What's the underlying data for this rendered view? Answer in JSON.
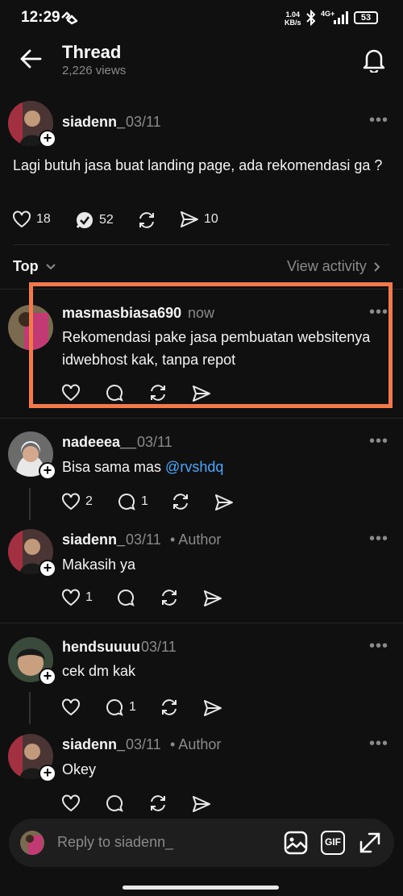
{
  "status": {
    "time": "12:29",
    "net_speed": "1.04",
    "net_unit": "KB/s",
    "network": "4G+",
    "battery": "53"
  },
  "header": {
    "title": "Thread",
    "views": "2,226 views"
  },
  "post": {
    "username": "siadenn_",
    "date": "03/11",
    "text": "Lagi butuh jasa buat landing page, ada rekomendasi ga ?",
    "likes": "18",
    "replies": "52",
    "shares": "10"
  },
  "sort": {
    "label": "Top",
    "view_activity": "View activity"
  },
  "replies": [
    {
      "username": "masmasbiasa690",
      "time": "now",
      "text_line1": "Rekomendasi pake jasa pembuatan websitenya",
      "text_line2": "idwebhost kak, tanpa repot"
    },
    {
      "username": "nadeeea__",
      "date": "03/11",
      "text": "Bisa sama mas ",
      "mention": "@rvshdq",
      "likes": "2",
      "replies": "1"
    },
    {
      "username": "siadenn_",
      "date": "03/11",
      "author": "• Author",
      "text": "Makasih ya",
      "likes": "1"
    },
    {
      "username": "hendsuuuu",
      "date": "03/11",
      "text": "cek dm kak",
      "replies": "1"
    },
    {
      "username": "siadenn_",
      "date": "03/11",
      "author": "• Author",
      "text": "Okey"
    }
  ],
  "reply_bar": {
    "placeholder": "Reply to siadenn_",
    "gif_label": "GIF"
  },
  "colors": {
    "background": "#101010",
    "highlight": "#f2794a",
    "mention": "#4aa8ff"
  }
}
